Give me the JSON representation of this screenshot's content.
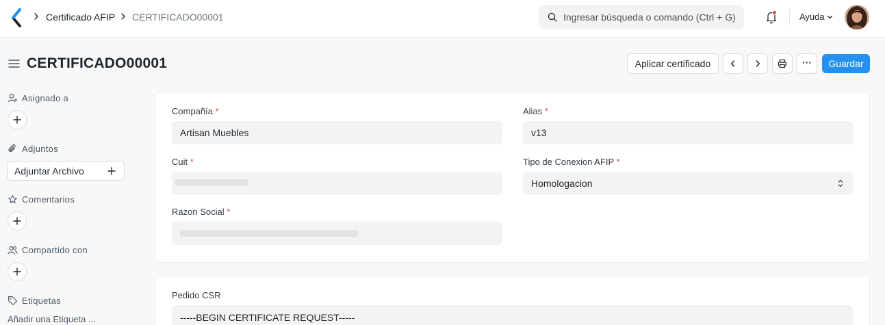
{
  "navbar": {
    "breadcrumbs": [
      "Certificado AFIP",
      "CERTIFICADO00001"
    ],
    "search_placeholder": "Ingresar búsqueda o comando (Ctrl + G)",
    "help_label": "Ayuda"
  },
  "page": {
    "title": "CERTIFICADO00001",
    "actions": {
      "apply_label": "Aplicar certificado",
      "more_label": "···",
      "save_label": "Guardar"
    }
  },
  "sidebar": {
    "assigned_label": "Asignado a",
    "attachments_label": "Adjuntos",
    "attach_button_label": "Adjuntar Archivo",
    "comments_label": "Comentarios",
    "shared_label": "Compartido con",
    "tags_label": "Etiquetas",
    "add_tag_label": "Añadir una Etiqueta ..."
  },
  "form": {
    "company": {
      "label": "Compañía",
      "required": "*",
      "value": "Artisan Muebles"
    },
    "alias": {
      "label": "Alias",
      "required": "*",
      "value": "v13"
    },
    "cuit": {
      "label": "Cuit",
      "required": "*"
    },
    "connection_type": {
      "label": "Tipo de Conexion AFIP",
      "required": "*",
      "value": "Homologacion"
    },
    "business_name": {
      "label": "Razon Social",
      "required": "*"
    },
    "csr": {
      "label": "Pedido CSR",
      "value": "-----BEGIN CERTIFICATE REQUEST-----"
    }
  },
  "colors": {
    "primary": "#2490ef",
    "required": "#e24c4c",
    "notification_dot": "#e24c4c"
  },
  "icons": [
    "app-logo-icon",
    "chevron-right-icon",
    "search-icon",
    "bell-icon",
    "chevron-down-icon",
    "hamburger-icon",
    "chevron-left-icon",
    "printer-icon",
    "user-plus-icon",
    "paperclip-icon",
    "star-icon",
    "users-icon",
    "tag-icon",
    "plus-icon",
    "select-arrows-icon"
  ]
}
